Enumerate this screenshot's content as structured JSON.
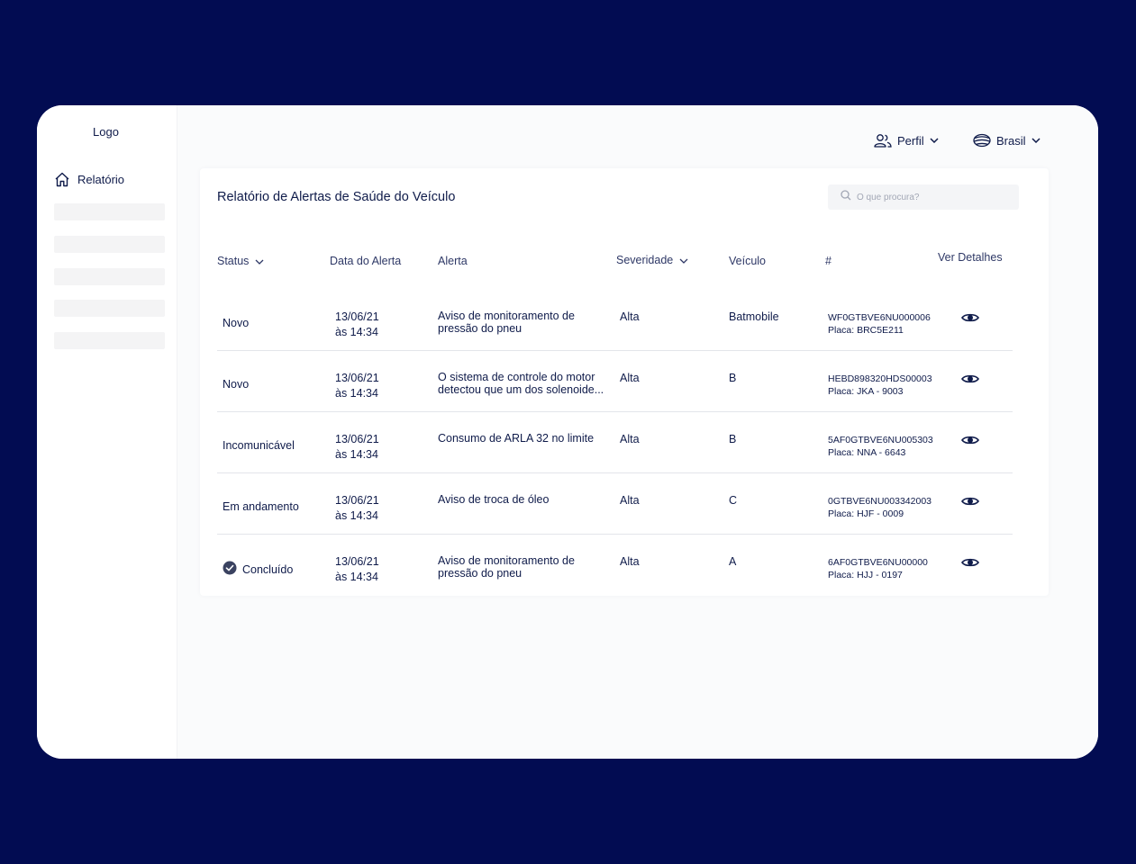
{
  "sidebar": {
    "logo": "Logo",
    "nav_report": "Relatório"
  },
  "topbar": {
    "profile": "Perfil",
    "country": "Brasil"
  },
  "report": {
    "title": "Relatório de Alertas de Saúde do Veículo",
    "search_placeholder": "O que procura?",
    "columns": {
      "status": "Status",
      "date": "Data do Alerta",
      "alert": "Alerta",
      "severity": "Severidade",
      "vehicle": "Veículo",
      "id": "#",
      "details": "Ver Detalhes"
    },
    "rows": [
      {
        "status": "Novo",
        "date": "13/06/21",
        "time": "às 14:34",
        "alert_l1": "Aviso de monitoramento de",
        "alert_l2": "pressão do pneu",
        "severity": "Alta",
        "vehicle": "Batmobile",
        "vin": "WF0GTBVE6NU000006",
        "plate": "Placa: BRC5E211"
      },
      {
        "status": "Novo",
        "date": "13/06/21",
        "time": "às 14:34",
        "alert_l1": "O sistema de controle do motor",
        "alert_l2": "detectou que um dos solenoide...",
        "severity": "Alta",
        "vehicle": "B",
        "vin": "HEBD898320HDS00003",
        "plate": "Placa: JKA - 9003"
      },
      {
        "status": "Incomunicável",
        "date": "13/06/21",
        "time": "às 14:34",
        "alert_l1": "Consumo de ARLA 32 no limite",
        "alert_l2": "",
        "severity": "Alta",
        "vehicle": "B",
        "vin": "5AF0GTBVE6NU005303",
        "plate": "Placa: NNA - 6643"
      },
      {
        "status": "Em andamento",
        "date": "13/06/21",
        "time": "às 14:34",
        "alert_l1": "Aviso de troca de óleo",
        "alert_l2": "",
        "severity": "Alta",
        "vehicle": "C",
        "vin": "0GTBVE6NU003342003",
        "plate": "Placa: HJF - 0009"
      },
      {
        "status": "Concluído",
        "date": "13/06/21",
        "time": "às 14:34",
        "alert_l1": "Aviso de monitoramento de",
        "alert_l2": "pressão do pneu",
        "severity": "Alta",
        "vehicle": "A",
        "vin": "6AF0GTBVE6NU00000",
        "plate": "Placa: HJJ - 0197"
      }
    ]
  },
  "icons": {
    "home": "home-icon",
    "profile": "users-icon",
    "country": "globe-icon",
    "search": "search-icon",
    "view": "eye-icon",
    "done": "check-circle-icon",
    "chevron": "chevron-down-icon"
  },
  "colors": {
    "background": "#020c52",
    "text": "#0f1b4a",
    "divider": "#e3e5ea"
  }
}
